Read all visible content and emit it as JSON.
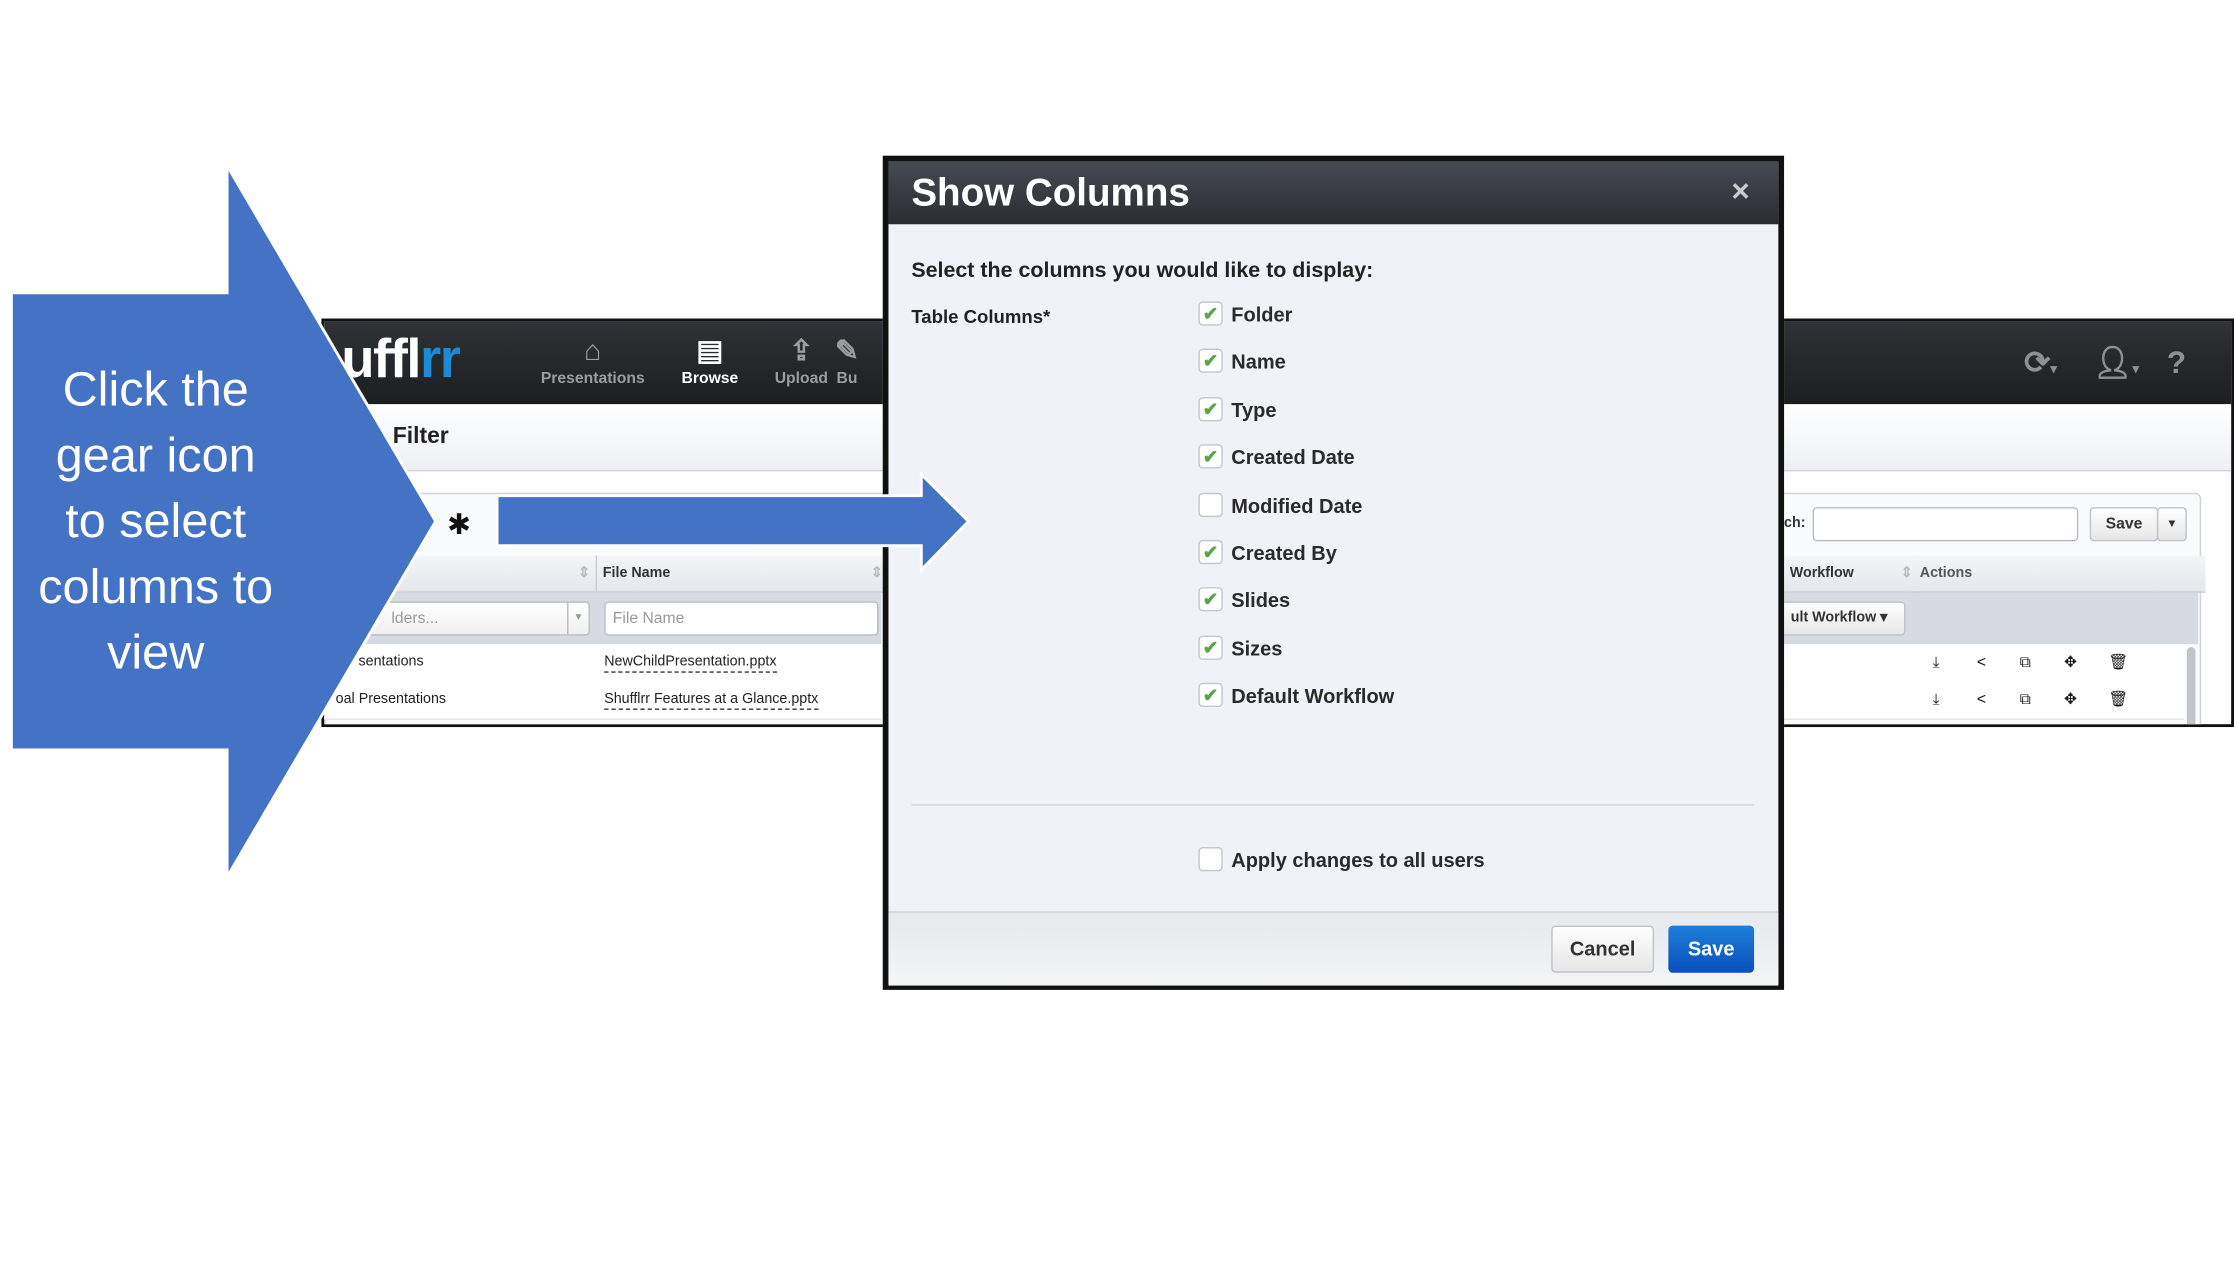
{
  "callout": {
    "lines": [
      "Click the",
      "gear icon",
      "to select",
      "columns to",
      "view"
    ],
    "color": "#4472c4"
  },
  "app": {
    "logo": {
      "part1": "uffl",
      "part2": "rr",
      "accent": "#1b8bd3"
    },
    "nav": [
      {
        "label": "Presentations",
        "icon": "presentation-board-icon"
      },
      {
        "label": "Browse",
        "icon": "browse-document-icon",
        "active": true
      },
      {
        "label": "Upload",
        "icon": "upload-icon"
      },
      {
        "label": "Bu",
        "icon": "build-icon"
      }
    ],
    "right_icons": [
      "sync-icon",
      "user-icon",
      "help-icon"
    ],
    "help_glyph": "?",
    "filter_title": "Filter",
    "search_label": "ch:",
    "search_value": "",
    "save_label": "Save",
    "columns": {
      "file_name": "File Name",
      "workflow": "Workflow",
      "actions": "Actions"
    },
    "filters": {
      "folders_placeholder": "lders...",
      "file_name_placeholder": "File Name",
      "workflow_value": "ult Workflow"
    },
    "rows": [
      {
        "folder": "sentations",
        "file": "NewChildPresentation.pptx"
      },
      {
        "folder": "oal Presentations",
        "file": "Shufflrr Features at a Glance.pptx"
      }
    ],
    "action_icons": [
      "download-icon",
      "share-icon",
      "copy-icon",
      "move-icon",
      "trash-icon"
    ]
  },
  "modal": {
    "title": "Show Columns",
    "close_glyph": "×",
    "prompt": "Select the columns you would like to display:",
    "field_label": "Table Columns*",
    "options": [
      {
        "label": "Folder",
        "checked": true
      },
      {
        "label": "Name",
        "checked": true
      },
      {
        "label": "Type",
        "checked": true
      },
      {
        "label": "Created Date",
        "checked": true
      },
      {
        "label": "Modified Date",
        "checked": false
      },
      {
        "label": "Created By",
        "checked": true
      },
      {
        "label": "Slides",
        "checked": true
      },
      {
        "label": "Sizes",
        "checked": true
      },
      {
        "label": "Default Workflow",
        "checked": true
      }
    ],
    "apply_all": {
      "label": "Apply changes to all users",
      "checked": false
    },
    "cancel_label": "Cancel",
    "save_label": "Save",
    "save_color": "#1565c8"
  }
}
